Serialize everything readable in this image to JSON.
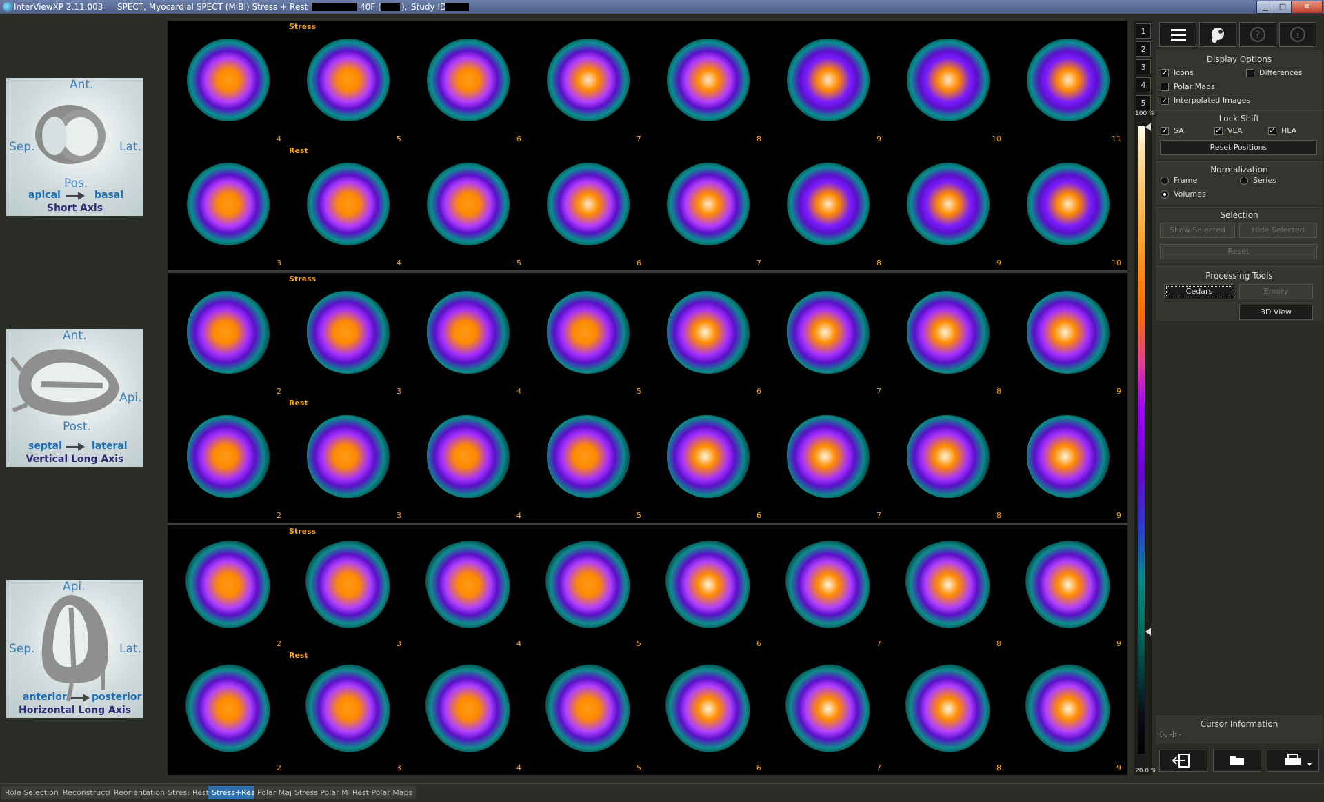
{
  "window": {
    "app_title": "InterViewXP 2.11.003",
    "study_title": "SPECT, Myocardial SPECT (MIBI) Stress + Rest",
    "patient_info": "40F (",
    "patient_info_close": "),",
    "study_id_label": "Study ID:"
  },
  "legends": [
    {
      "ant": "Ant.",
      "sep": "Sep.",
      "lat": "Lat.",
      "pos": "Pos.",
      "from": "apical",
      "to": "basal",
      "title": "Short Axis"
    },
    {
      "ant": "Ant.",
      "api": "Api.",
      "post": "Post.",
      "from": "septal",
      "to": "lateral",
      "title": "Vertical Long Axis"
    },
    {
      "api": "Api.",
      "sep": "Sep.",
      "lat": "Lat.",
      "from": "anterior",
      "to": "posterior",
      "title": "Horizontal Long Axis"
    }
  ],
  "viewer": {
    "groups": [
      {
        "rows": [
          {
            "label": "Stress",
            "slices": [
              "4",
              "5",
              "6",
              "7",
              "8",
              "9",
              "10",
              "11"
            ]
          },
          {
            "label": "Rest",
            "slices": [
              "3",
              "4",
              "5",
              "6",
              "7",
              "8",
              "9",
              "10"
            ]
          }
        ]
      },
      {
        "rows": [
          {
            "label": "Stress",
            "slices": [
              "2",
              "3",
              "4",
              "5",
              "6",
              "7",
              "8",
              "9"
            ]
          },
          {
            "label": "Rest",
            "slices": [
              "2",
              "3",
              "4",
              "5",
              "6",
              "7",
              "8",
              "9"
            ]
          }
        ]
      },
      {
        "rows": [
          {
            "label": "Stress",
            "slices": [
              "2",
              "3",
              "4",
              "5",
              "6",
              "7",
              "8",
              "9"
            ]
          },
          {
            "label": "Rest",
            "slices": [
              "2",
              "3",
              "4",
              "5",
              "6",
              "7",
              "8",
              "9"
            ]
          }
        ]
      }
    ]
  },
  "page_buttons": [
    "1",
    "2",
    "3",
    "4",
    "5"
  ],
  "color_scale": {
    "top": "100 %",
    "bottom": "20.0 %"
  },
  "toolbar": {
    "menu_icon": "hamburger-menu-icon",
    "palette_icon": "palette-icon",
    "help_icon": "help-icon",
    "info_icon": "info-icon"
  },
  "display_options": {
    "title": "Display Options",
    "icons": {
      "label": "Icons",
      "checked": true
    },
    "differences": {
      "label": "Differences",
      "checked": false
    },
    "polar_maps": {
      "label": "Polar Maps",
      "checked": false
    },
    "interpolated": {
      "label": "Interpolated Images",
      "checked": true
    }
  },
  "lock_shift": {
    "title": "Lock Shift",
    "sa": {
      "label": "SA",
      "checked": true
    },
    "vla": {
      "label": "VLA",
      "checked": true
    },
    "hla": {
      "label": "HLA",
      "checked": true
    },
    "reset_label": "Reset Positions"
  },
  "normalization": {
    "title": "Normalization",
    "frame": "Frame",
    "series": "Series",
    "volumes": "Volumes",
    "selected": "Volumes"
  },
  "selection": {
    "title": "Selection",
    "show_selected": "Show Selected",
    "hide_selected": "Hide Selected",
    "reset": "Reset"
  },
  "processing_tools": {
    "title": "Processing Tools",
    "cedars": "Cedars",
    "emory": "Emory",
    "view3d": "3D View"
  },
  "cursor_info": {
    "title": "Cursor Information",
    "value": "[-, -]: -"
  },
  "bottom_icons": [
    "exit-icon",
    "open-folder-icon",
    "print-icon"
  ],
  "tabs": [
    {
      "label": "Role Selection",
      "active": false
    },
    {
      "label": "Reconstruction",
      "active": false
    },
    {
      "label": "Reorientation",
      "active": false
    },
    {
      "label": "Stress",
      "active": false
    },
    {
      "label": "Rest",
      "active": false
    },
    {
      "label": "Stress+Rest",
      "active": true
    },
    {
      "label": "Polar Maps",
      "active": false
    },
    {
      "label": "Stress Polar Maps",
      "active": false
    },
    {
      "label": "Rest Polar Maps",
      "active": false
    }
  ]
}
